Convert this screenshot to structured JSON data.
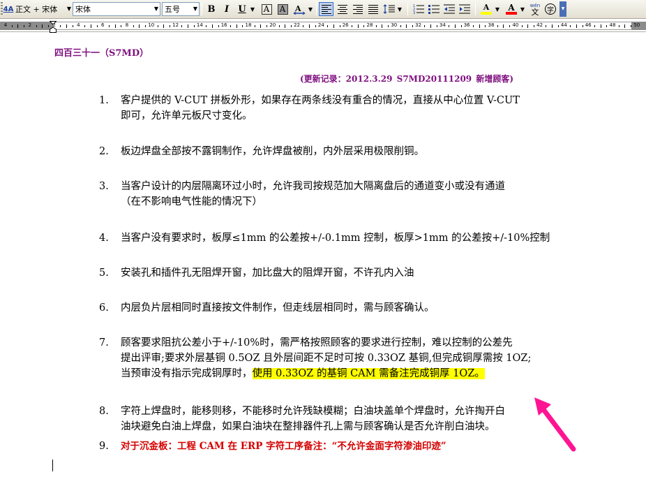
{
  "toolbar": {
    "style_icon_text": "4A",
    "style_text": "正文 + 宋体",
    "font_name": "宋体",
    "font_size": "五号",
    "bold": "B",
    "italic": "I",
    "underline": "U",
    "char_border": "A",
    "char_shading": "A",
    "highlight_glyph": "A",
    "font_color_glyph": "A",
    "phonetic_top": "wén",
    "phonetic_bottom": "文",
    "enclosed_char": "字",
    "highlight_color": "#ffff00",
    "font_color": "#ff0000"
  },
  "ruler": {
    "labels": [
      "4",
      "2",
      "2",
      "4",
      "6",
      "8",
      "10",
      "12",
      "14",
      "16",
      "18",
      "20",
      "22",
      "24",
      "26",
      "28",
      "30",
      "32",
      "34",
      "36",
      "38",
      "40",
      "42",
      "44",
      "46",
      "48",
      "50"
    ]
  },
  "document": {
    "title": "四百三十一（S7MD）",
    "update_record": "(更新记录：2012.3.29     S7MD20111209     新增顾客)",
    "items": [
      {
        "num": "1.",
        "lines": [
          "客户提供的 V-CUT 拼板外形，如果存在两条线没有重合的情况，直接从中心位置 V-CUT",
          "即可，允许单元板尺寸变化。"
        ]
      },
      {
        "num": "2.",
        "lines": [
          "板边焊盘全部按不露铜制作，允许焊盘被削，内外层采用极限削铜。"
        ]
      },
      {
        "num": "3.",
        "lines": [
          "当客户设计的内层隔离环过小时，允许我司按规范加大隔离盘后的通道变小或没有通道",
          "（在不影响电气性能的情况下）"
        ]
      },
      {
        "num": "4.",
        "lines": [
          "当客户没有要求时，板厚≤1mm 的公差按+/-0.1mm 控制，板厚>1mm 的公差按+/-10%控制"
        ]
      },
      {
        "num": "5.",
        "lines": [
          "安装孔和插件孔无阻焊开窗，加比盘大的阻焊开窗，不许孔内入油"
        ]
      },
      {
        "num": "6.",
        "lines": [
          "内层负片层相同时直接按文件制作，但走线层相同时，需与顾客确认。"
        ]
      },
      {
        "num": "7.",
        "lines": [
          "顾客要求阻抗公差小于+/-10%时，需严格按照顾客的要求进行控制，难以控制的公差先",
          "提出评审;要求外层基铜 0.5OZ 且外层间距不足时可按 0.33OZ 基铜,但完成铜厚需按 1OZ;",
          "当预审没有指示完成铜厚时，"
        ],
        "highlight": "使用 0.33OZ 的基铜 CAM 需备注完成铜厚 1OZ。"
      },
      {
        "num": "8.",
        "lines": [
          "字符上焊盘时，能移则移，不能移时允许残缺模糊；白油块盖单个焊盘时，允许掏开白",
          "油块避免白油上焊盘，如果白油块在整排器件孔上需与顾客确认是否允许削白油块。"
        ]
      },
      {
        "num": "9.",
        "lines": [
          "对于沉金板：工程 CAM 在 ERP 字符工序备注：“不允许金面字符渗油印迹”"
        ]
      }
    ]
  },
  "colors": {
    "heading": "#7f0f7f",
    "highlight": "#ffff00",
    "red_text": "#d40000",
    "annotation_arrow": "#ff1493"
  }
}
